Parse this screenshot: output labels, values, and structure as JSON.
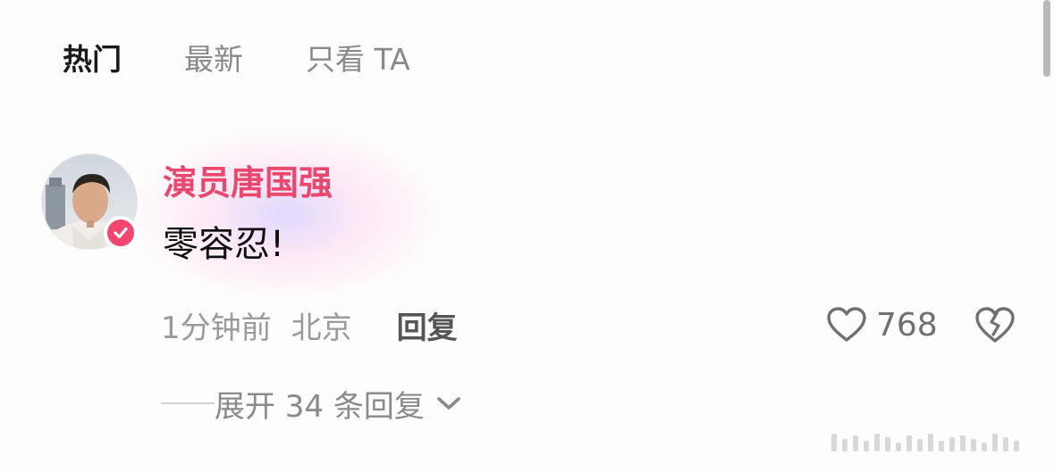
{
  "tabs": [
    {
      "label": "热门",
      "active": true
    },
    {
      "label": "最新",
      "active": false
    },
    {
      "label": "只看 TA",
      "active": false
    }
  ],
  "comment": {
    "username": "演员唐国强",
    "text": "零容忍!",
    "time": "1分钟前",
    "location": "北京",
    "reply_label": "回复",
    "like_count": "768",
    "verified": true,
    "expand_label": "展开 34 条回复"
  },
  "colors": {
    "username": "#e9476e",
    "verify_badge": "#f0466f",
    "active_tab": "#1a1a1a",
    "inactive_tab": "#8a8a8a"
  },
  "icons": {
    "like": "heart-outline-icon",
    "dislike": "broken-heart-icon",
    "expand": "chevron-down-icon",
    "verified": "checkmark-badge-icon"
  }
}
